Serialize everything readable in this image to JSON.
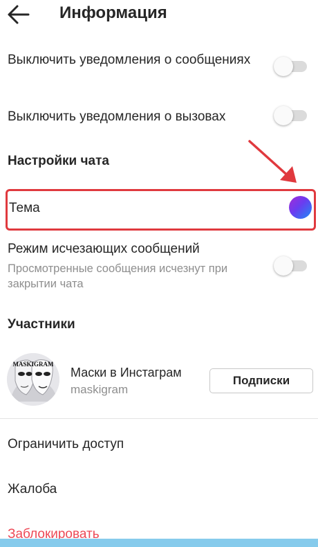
{
  "header": {
    "title": "Информация",
    "back_icon": "arrow-left-icon"
  },
  "notifications": {
    "mute_messages_label": "Выключить уведомления о сообщениях",
    "mute_messages_on": false,
    "mute_calls_label": "Выключить уведомления о вызовах",
    "mute_calls_on": false
  },
  "chat_settings": {
    "title": "Настройки чата",
    "theme_label": "Тема",
    "theme_colors": [
      "#a52bd6",
      "#6a3cf0",
      "#1e8cf5"
    ],
    "vanish_mode_label": "Режим исчезающих сообщений",
    "vanish_mode_desc": "Просмотренные сообщения исчезнут при закрытии чата",
    "vanish_mode_on": false
  },
  "members": {
    "title": "Участники",
    "items": [
      {
        "name": "Маски в Инстаграм",
        "username": "maskigram",
        "avatar_text": "MASKIGRAM",
        "button_label": "Подписки"
      }
    ]
  },
  "actions": {
    "restrict_label": "Ограничить доступ",
    "report_label": "Жалоба",
    "block_label": "Заблокировать"
  },
  "colors": {
    "highlight_border": "#e0393e",
    "annotation_arrow": "#e0393e",
    "danger_text": "#ed4956",
    "secondary_text": "#8e8e8e"
  }
}
